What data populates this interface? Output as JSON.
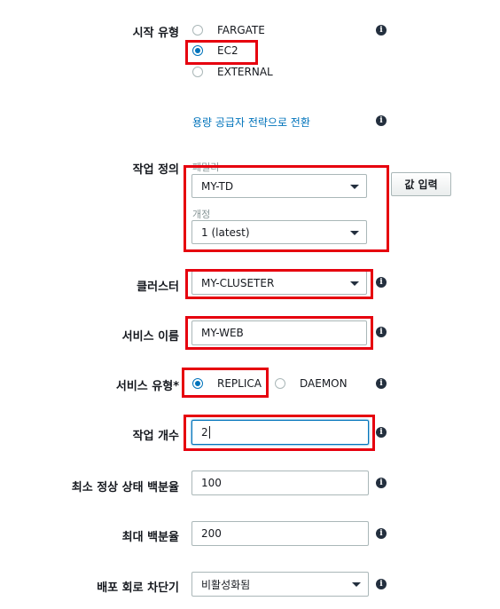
{
  "launch_type": {
    "label": "시작 유형",
    "options": [
      "FARGATE",
      "EC2",
      "EXTERNAL"
    ],
    "selected": "EC2",
    "switch_link": "용량 공급자 전략으로 전환"
  },
  "task_definition": {
    "label": "작업 정의",
    "family_label": "패밀리",
    "family_value": "MY-TD",
    "revision_label": "개정",
    "revision_value": "1 (latest)",
    "enter_value_button": "값 입력"
  },
  "cluster": {
    "label": "클러스터",
    "value": "MY-CLUSETER"
  },
  "service_name": {
    "label": "서비스 이름",
    "value": "MY-WEB"
  },
  "service_type": {
    "label": "서비스 유형*",
    "options": [
      "REPLICA",
      "DAEMON"
    ],
    "selected": "REPLICA"
  },
  "task_count": {
    "label": "작업 개수",
    "value": "2"
  },
  "min_healthy_percent": {
    "label": "최소 정상 상태 백분율",
    "value": "100"
  },
  "max_percent": {
    "label": "최대 백분율",
    "value": "200"
  },
  "circuit_breaker": {
    "label": "배포 회로 차단기",
    "value": "비활성화됨"
  },
  "icons": {
    "info": "info-icon",
    "dropdown": "caret-down-icon"
  },
  "colors": {
    "highlight": "#e6000e",
    "accent": "#0073bb",
    "link": "#0073bb"
  }
}
